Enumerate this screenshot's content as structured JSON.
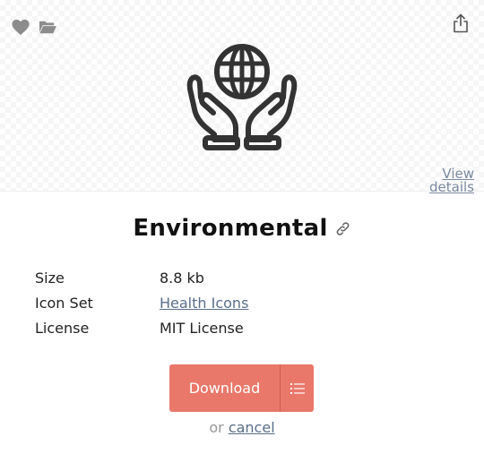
{
  "toolbar": {
    "favorite_icon": "heart-icon",
    "collection_icon": "folder-icon",
    "share_icon": "share-icon"
  },
  "preview": {
    "icon": "globe-in-hands-icon",
    "view_details_label": "View details"
  },
  "title": "Environmental",
  "details": [
    {
      "label": "Size",
      "value": "8.8 kb",
      "is_link": false
    },
    {
      "label": "Icon Set",
      "value": "Health Icons",
      "is_link": true
    },
    {
      "label": "License",
      "value": "MIT License",
      "is_link": false
    }
  ],
  "actions": {
    "download_label": "Download",
    "or_text": "or",
    "cancel_label": "cancel"
  },
  "colors": {
    "download_button": "#e9776a",
    "link": "#5a6f8a",
    "icon_gray": "#8c8c8c"
  }
}
